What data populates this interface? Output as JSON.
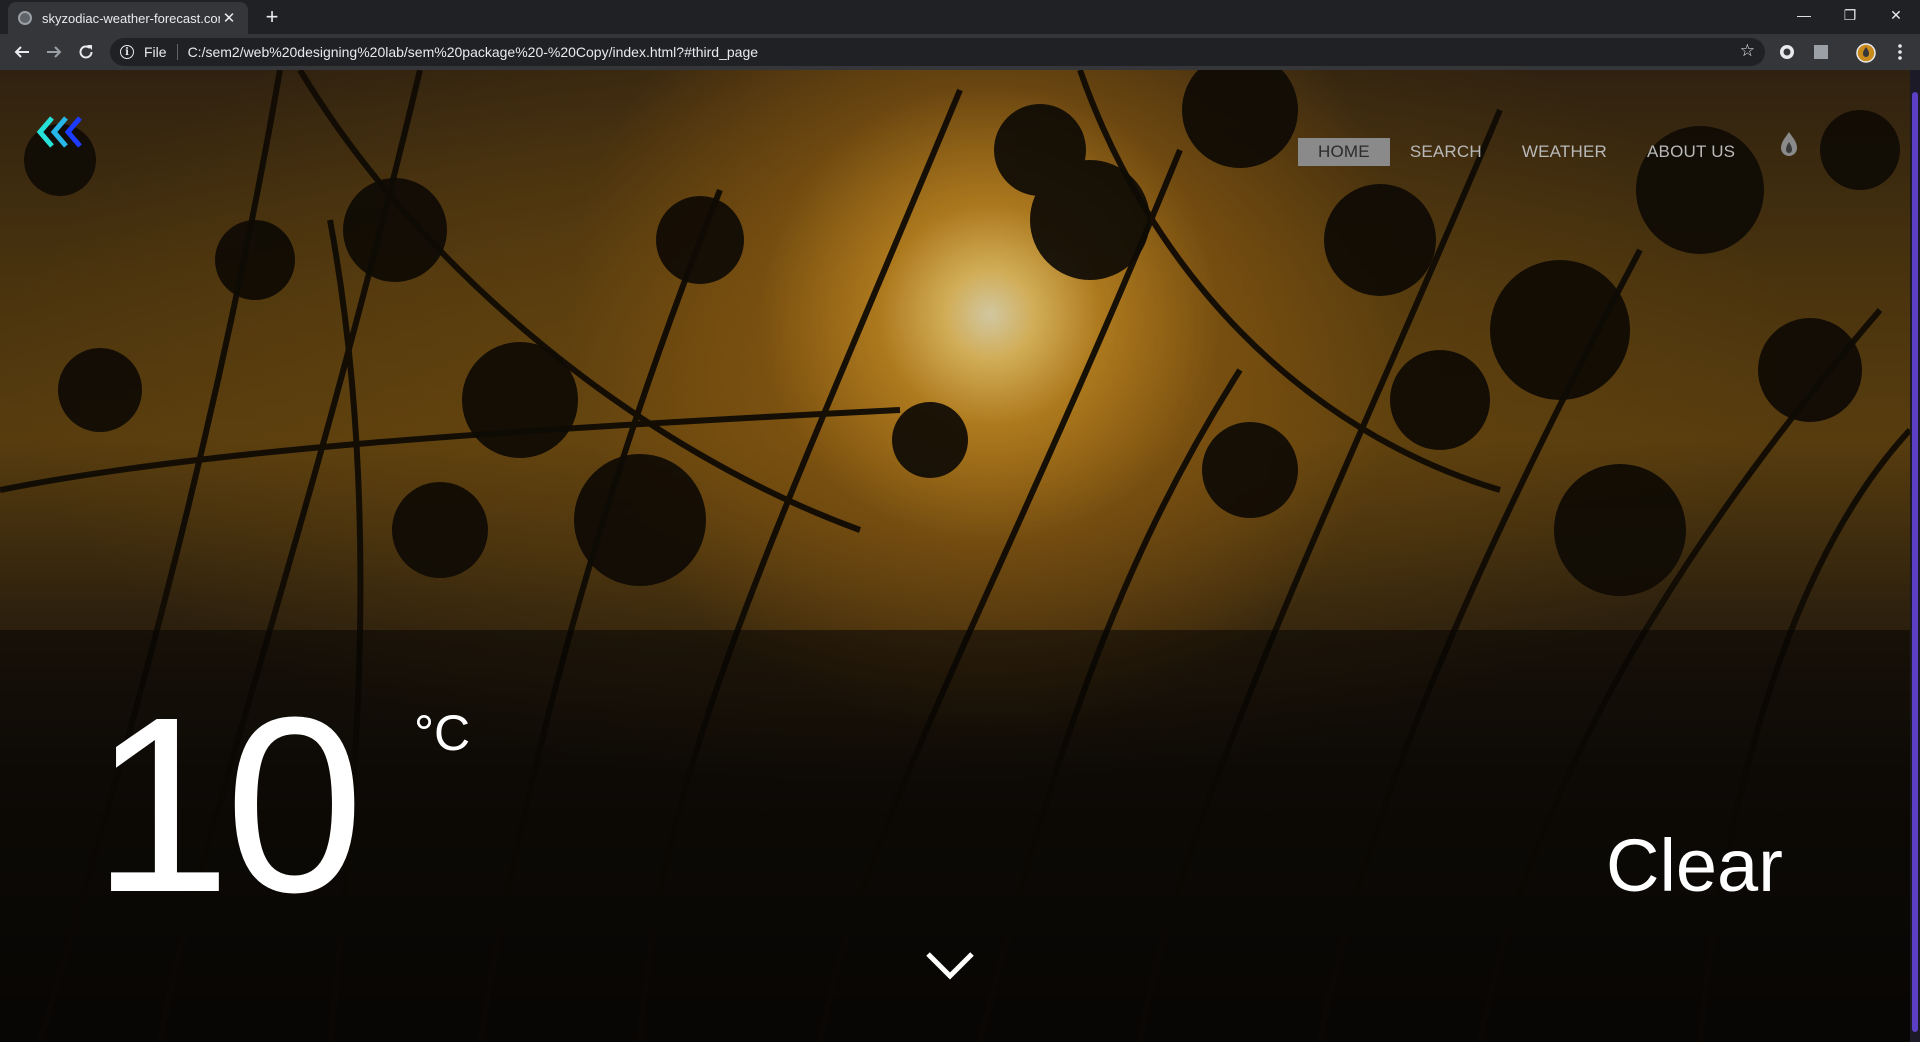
{
  "browser": {
    "tab_title": "skyzodiac-weather-forecast.com",
    "url_scheme": "File",
    "url": "C:/sem2/web%20designing%20lab/sem%20package%20-%20Copy/index.html?#third_page",
    "icons": {
      "back": "back-arrow-icon",
      "forward": "forward-arrow-icon",
      "reload": "reload-icon",
      "info": "info-icon",
      "bookmark": "star-icon",
      "new_tab": "plus-icon",
      "close_tab": "close-icon",
      "menu": "kebab-menu-icon"
    }
  },
  "page": {
    "nav": {
      "items": [
        "HOME",
        "SEARCH",
        "WEATHER",
        "ABOUT US"
      ],
      "active_index": 0
    },
    "weather": {
      "temperature": "10",
      "unit": "°C",
      "condition": "Clear"
    },
    "colors": {
      "logo_primary": "#27e1d8",
      "logo_secondary": "#1c3bff",
      "scroll_accent": "#5b3fc4",
      "nav_active_bg": "#8a8a8a"
    }
  }
}
